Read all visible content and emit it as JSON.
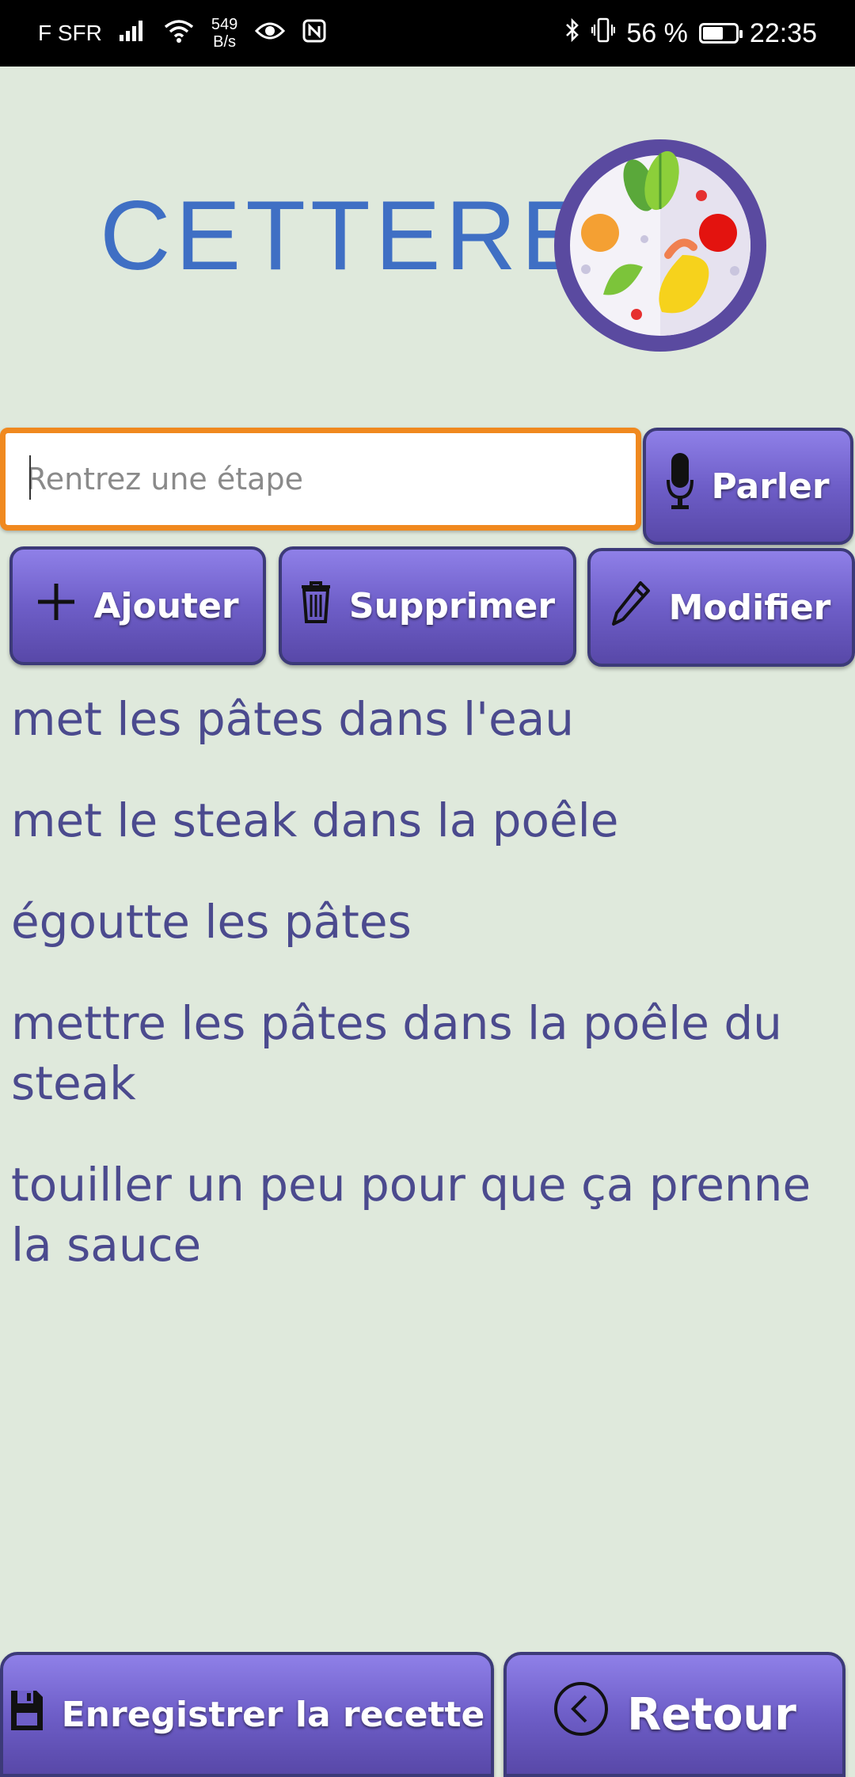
{
  "status_bar": {
    "carrier": "F SFR",
    "speed_value": "549",
    "speed_unit": "B/s",
    "battery": "56 %",
    "time": "22:35"
  },
  "header": {
    "logo_text": "CETTERE"
  },
  "step_input": {
    "placeholder": "Rentrez une étape",
    "value": ""
  },
  "buttons": {
    "speak": "Parler",
    "add": "Ajouter",
    "delete": "Supprimer",
    "edit": "Modifier",
    "save": "Enregistrer la recette",
    "back": "Retour"
  },
  "steps": [
    "met les pâtes dans l'eau",
    "met le steak dans la poêle",
    "égoutte les pâtes",
    "mettre les pâtes dans la poêle du steak",
    "touiller un peu pour que ça prenne la sauce"
  ],
  "colors": {
    "background": "#dfe9dc",
    "button": "#6e5ec8",
    "step_text": "#4b4a8e",
    "input_border": "#f0891f",
    "logo": "#3f6fc4"
  },
  "icons": {
    "speak": "microphone-icon",
    "add": "plus-icon",
    "delete": "trash-icon",
    "edit": "pencil-icon",
    "save": "floppy-disk-icon",
    "back": "chevron-left-circle-icon"
  }
}
